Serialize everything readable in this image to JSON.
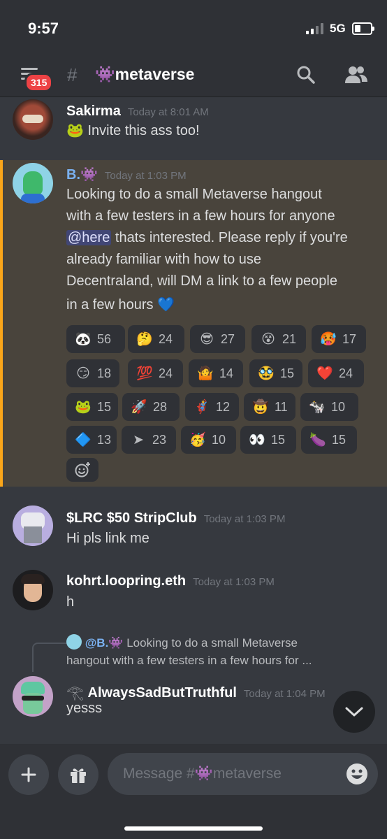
{
  "status": {
    "time": "9:57",
    "network": "5G"
  },
  "header": {
    "badge": "315",
    "channel_emoji": "👾",
    "channel_name": "metaverse"
  },
  "messages": [
    {
      "user": "Sakirma",
      "time": "Today at 8:01 AM",
      "emoji": "🐸",
      "text": "Invite this ass too!"
    },
    {
      "user": "B.",
      "user_emoji": "👾",
      "time": "Today at 1:03 PM",
      "line1": "Looking to do a small Metaverse hangout",
      "line2": "with a few testers in a few hours for anyone",
      "mention": "@here",
      "line3_rest": " thats interested. Please reply if you're",
      "line4": "already familiar with how to use",
      "line5": "Decentraland, will DM a link to a few people",
      "line6": "in a few hours",
      "line6_emoji": "💙",
      "reactions": [
        {
          "emoji": "🐼",
          "count": "56"
        },
        {
          "emoji": "🤔",
          "count": "24"
        },
        {
          "emoji": "😎",
          "count": "27"
        },
        {
          "emoji": "😵",
          "count": "21"
        },
        {
          "emoji": "🥵",
          "count": "17"
        },
        {
          "emoji": "😏",
          "count": "18"
        },
        {
          "emoji": "💯",
          "count": "24"
        },
        {
          "emoji": "🤷",
          "count": "14"
        },
        {
          "emoji": "🥸",
          "count": "15"
        },
        {
          "emoji": "❤️",
          "count": "24"
        },
        {
          "emoji": "🐸",
          "count": "15"
        },
        {
          "emoji": "🚀",
          "count": "28"
        },
        {
          "emoji": "🦸",
          "count": "12"
        },
        {
          "emoji": "🤠",
          "count": "11"
        },
        {
          "emoji": "🐄",
          "count": "10"
        },
        {
          "emoji": "🔷",
          "count": "13"
        },
        {
          "emoji": "➤",
          "count": "23"
        },
        {
          "emoji": "🥳",
          "count": "10"
        },
        {
          "emoji": "👀",
          "count": "15"
        },
        {
          "emoji": "🍆",
          "count": "15"
        }
      ]
    },
    {
      "user": "$LRC  $50  StripClub",
      "time": "Today at 1:03 PM",
      "text": "Hi pls link me"
    },
    {
      "user": "kohrt.loopring.eth",
      "time": "Today at 1:03 PM",
      "text": "h"
    },
    {
      "reply_user": "@B.",
      "reply_user_emoji": "👾",
      "reply_line1": " Looking to do a small Metaverse",
      "reply_line2": "hangout with a few testers in a few hours for ...",
      "user_icon": "𓂀",
      "user": "AlwaysSadButTruthful",
      "time": "Today at 1:04 PM",
      "text": "yesss"
    }
  ],
  "composer": {
    "placeholder_prefix": "Message #",
    "channel_emoji": "👾",
    "channel_name": "metaverse"
  }
}
